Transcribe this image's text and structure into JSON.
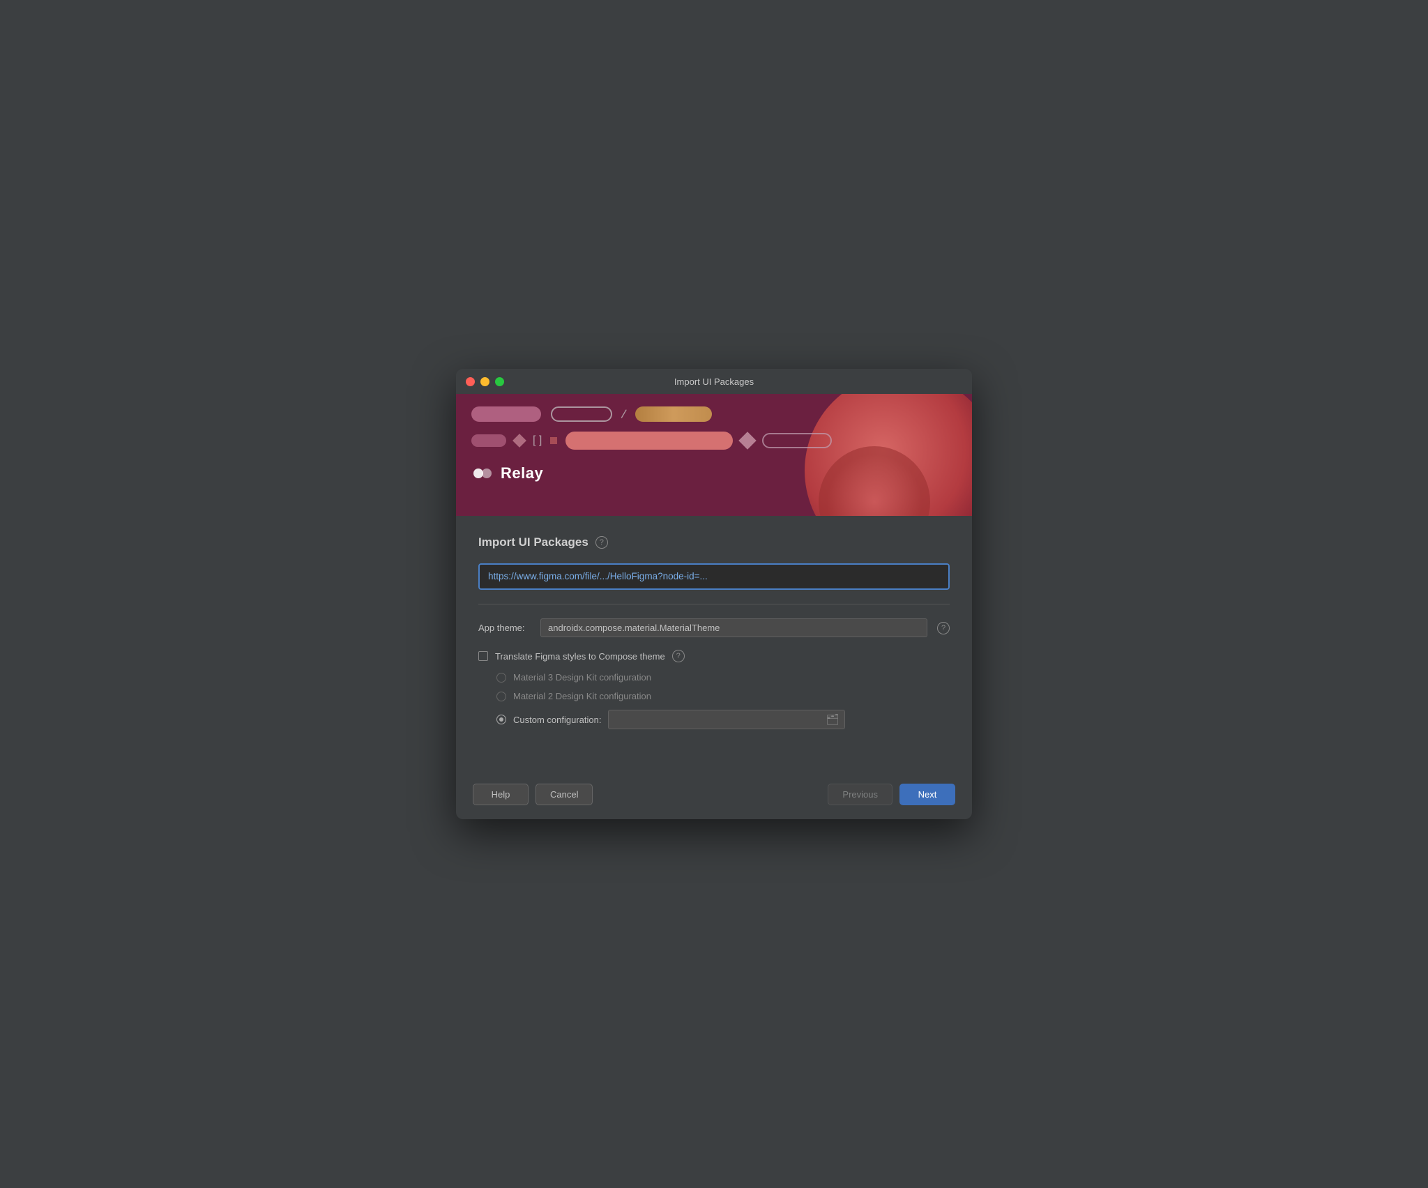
{
  "window": {
    "title": "Import UI Packages"
  },
  "hero": {
    "relay_name": "Relay"
  },
  "main": {
    "section_title": "Import UI Packages",
    "help_tooltip": "?",
    "url_input": {
      "value": "https://www.figma.com/file/.../HelloFigma?node-id=...",
      "placeholder": "https://www.figma.com/file/.../HelloFigma?node-id=..."
    },
    "app_theme": {
      "label": "App theme:",
      "value": "androidx.compose.material.MaterialTheme",
      "help_tooltip": "?"
    },
    "translate_checkbox": {
      "label": "Translate Figma styles to Compose theme",
      "checked": false,
      "help_tooltip": "?"
    },
    "radio_options": [
      {
        "id": "material3",
        "label": "Material 3 Design Kit configuration",
        "selected": false
      },
      {
        "id": "material2",
        "label": "Material 2 Design Kit configuration",
        "selected": false
      },
      {
        "id": "custom",
        "label": "Custom configuration:",
        "selected": true
      }
    ],
    "custom_config_placeholder": ""
  },
  "footer": {
    "help_label": "Help",
    "cancel_label": "Cancel",
    "previous_label": "Previous",
    "next_label": "Next"
  }
}
